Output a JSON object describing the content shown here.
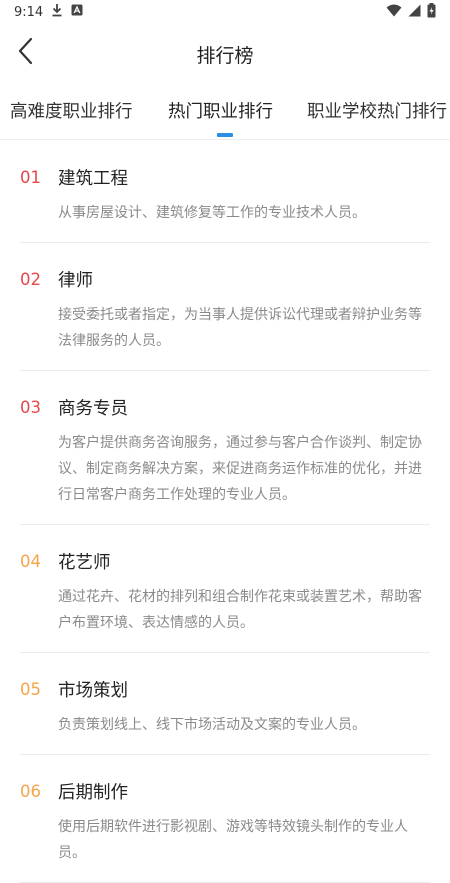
{
  "status_bar": {
    "time": "9:14",
    "icons": [
      "download-icon",
      "a-square-icon",
      "wifi-icon",
      "signal-icon",
      "battery-icon"
    ]
  },
  "header": {
    "title": "排行榜",
    "back_icon": "chevron-left-icon"
  },
  "tabs": [
    {
      "label": "高难度职业排行",
      "active": false
    },
    {
      "label": "热门职业排行",
      "active": true
    },
    {
      "label": "职业学校热门排行",
      "active": false
    }
  ],
  "colors": {
    "rank_red": "#e8474b",
    "rank_orange": "#f5a449",
    "accent": "#2b8ee9",
    "desc": "#8a8a8a"
  },
  "items": [
    {
      "rank": "01",
      "name": "建筑工程",
      "desc": "从事房屋设计、建筑修复等工作的专业技术人员。"
    },
    {
      "rank": "02",
      "name": "律师",
      "desc": "接受委托或者指定，为当事人提供诉讼代理或者辩护业务等法律服务的人员。"
    },
    {
      "rank": "03",
      "name": "商务专员",
      "desc": "为客户提供商务咨询服务，通过参与客户合作谈判、制定协议、制定商务解决方案，来促进商务运作标准的优化，并进行日常客户商务工作处理的专业人员。"
    },
    {
      "rank": "04",
      "name": "花艺师",
      "desc": "通过花卉、花材的排列和组合制作花束或装置艺术，帮助客户布置环境、表达情感的人员。"
    },
    {
      "rank": "05",
      "name": "市场策划",
      "desc": "负责策划线上、线下市场活动及文案的专业人员。"
    },
    {
      "rank": "06",
      "name": "后期制作",
      "desc": "使用后期软件进行影视剧、游戏等特效镜头制作的专业人员。"
    }
  ]
}
